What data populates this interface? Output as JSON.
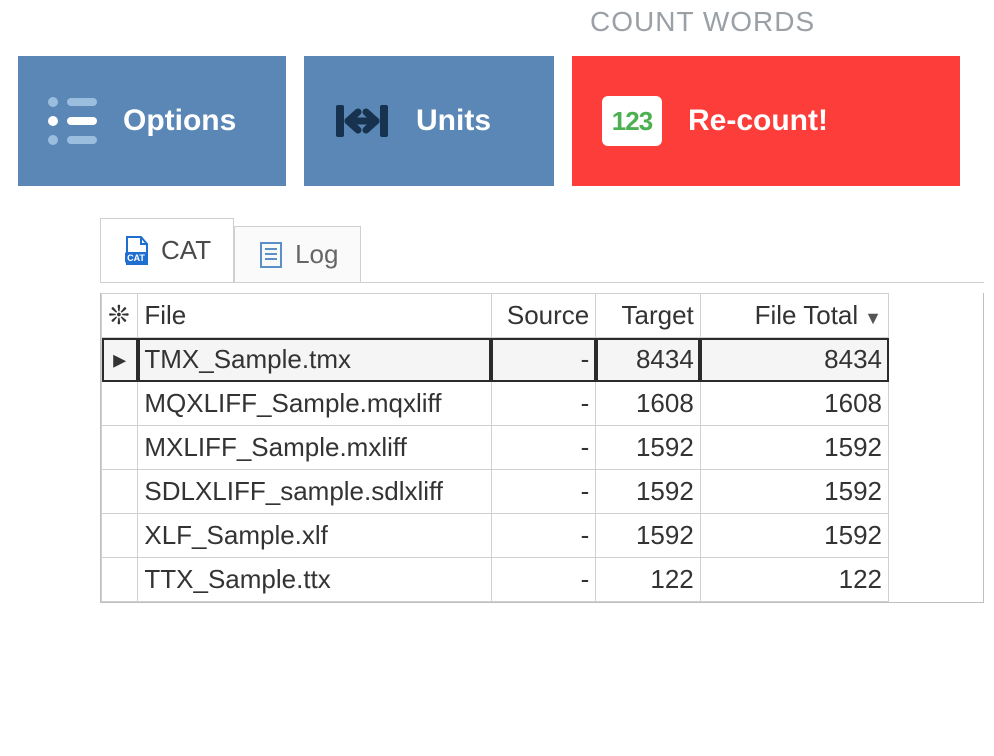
{
  "section_label": "COUNT WORDS",
  "toolbar": {
    "options_label": "Options",
    "units_label": "Units",
    "recount_label": "Re-count!"
  },
  "tabs": {
    "cat_label": "CAT",
    "log_label": "Log",
    "active": "cat"
  },
  "grid": {
    "columns": {
      "marker": "❊",
      "file": "File",
      "source": "Source",
      "target": "Target",
      "total": "File Total"
    },
    "sort": {
      "column": "total",
      "dir": "desc"
    },
    "rows": [
      {
        "selected": true,
        "file": "TMX_Sample.tmx",
        "source": "-",
        "target": 8434,
        "total": 8434
      },
      {
        "selected": false,
        "file": "MQXLIFF_Sample.mqxliff",
        "source": "-",
        "target": 1608,
        "total": 1608
      },
      {
        "selected": false,
        "file": "MXLIFF_Sample.mxliff",
        "source": "-",
        "target": 1592,
        "total": 1592
      },
      {
        "selected": false,
        "file": "SDLXLIFF_sample.sdlxliff",
        "source": "-",
        "target": 1592,
        "total": 1592
      },
      {
        "selected": false,
        "file": "XLF_Sample.xlf",
        "source": "-",
        "target": 1592,
        "total": 1592
      },
      {
        "selected": false,
        "file": "TTX_Sample.ttx",
        "source": "-",
        "target": 122,
        "total": 122
      }
    ]
  }
}
